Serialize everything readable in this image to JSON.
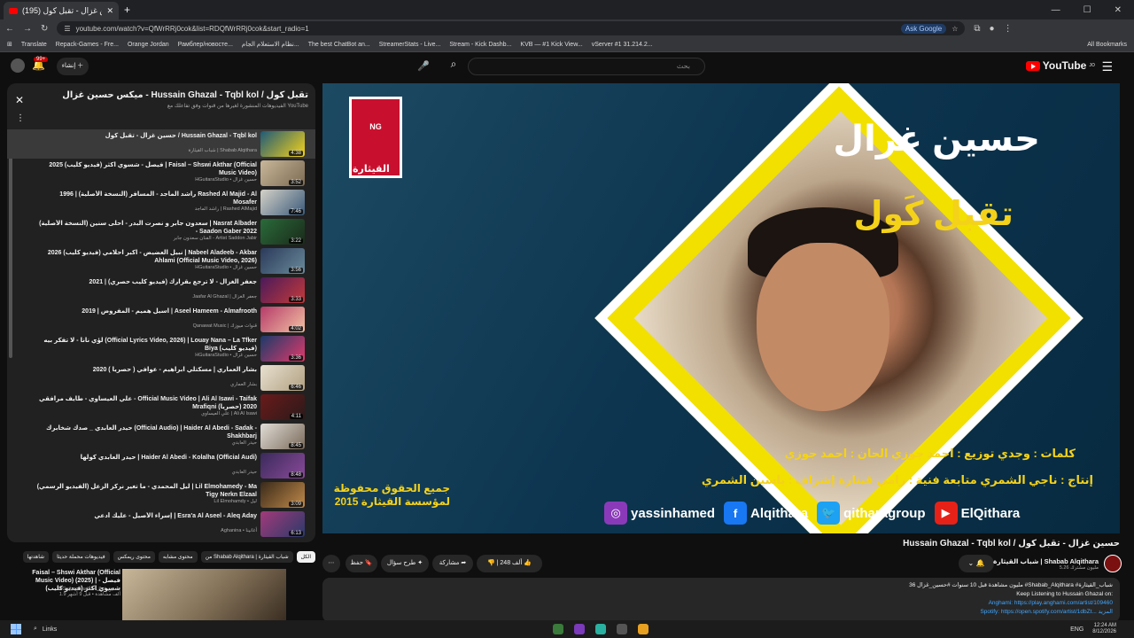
{
  "browser": {
    "tab_title": "(195) حسين غزال - تقبل كول",
    "url": "youtube.com/watch?v=QfWrRRj0cok&list=RDQfWrRRj0cok&start_radio=1",
    "ask_google": "Ask Google",
    "all_bookmarks": "All Bookmarks"
  },
  "bookmarks": [
    "Translate",
    "Repack-Games - Fre...",
    "Orange Jordan",
    "Рамблер/новосте...",
    "نظام الاستعلام الجام...",
    "The best ChatBot an...",
    "StreamerStats - Live...",
    "Stream - Kick Dashb...",
    "KVB — #1 Kick View...",
    "vServer #1 31.214.2..."
  ],
  "header": {
    "notif_count": "99+",
    "create_label": "إنشاء",
    "search_placeholder": "بحث",
    "logo": "YouTube",
    "logo_sup": "JO"
  },
  "playlist": {
    "title": "ميكس حسين غزال - Hussain Ghazal - Tqbl kol / تقبل كول",
    "subtitle": "الفيديوهات المنشورة لغيرها من قنوات وفق تفاعلك مع YouTube",
    "items": [
      {
        "title": "حسين غزال - تقبل كول / Hussain Ghazal - Tqbl kol",
        "channel": "شباب القيثارة | Shabab Alqithara",
        "dur": "4:38",
        "c1": "#1e5a78",
        "c2": "#f4d21a"
      },
      {
        "title": "فيصل - شسوي اكثر (فيديو كليب) 2025 | Faisal – Shswi Akthar (Official Music Video)",
        "channel": "HGuitaraStudio • حسين غزال",
        "dur": "3:52",
        "c1": "#c9b79a",
        "c2": "#7c6a52"
      },
      {
        "title": "راشد الماجد - المسافر (النسخة الأصلية) | 1996 Rashed Al Majid - Al Mosafer",
        "channel": "راشد الماجد | Rashed AlMajid",
        "dur": "7:46",
        "c1": "#d6d2c8",
        "c2": "#3a5a7a"
      },
      {
        "title": "سعدون جابر و نصرت البدر - احلى سنين (النسخة الأصلية) | Nasrat Albader - Saadon Gaber 2022",
        "channel": "الفنان سعدون جابر - Artist Saddon Jabir",
        "dur": "3:22",
        "c1": "#2a6b3a",
        "c2": "#1a2a1a"
      },
      {
        "title": "نبيل العضيض - اكبر احلامي (فيديو كليب) 2026 | Nabeel Aladeeb - Akbar Ahlami (Official Music Video, 2026)",
        "channel": "HGuitaraStudio • حسين غزال",
        "dur": "3:56",
        "c1": "#2a3a5a",
        "c2": "#6a8a9a"
      },
      {
        "title": "جعفر الغزال - لا ترجع بقرارك (فيديو كليب حصري) | 2021",
        "channel": "Jaafar Al Ghazal | جعفر الغزال",
        "dur": "3:33",
        "c1": "#4a1a5a",
        "c2": "#c43a3a"
      },
      {
        "title": "اسيل هميم - المفروض | 2019 | Aseel Hameem - Almafrooth",
        "channel": "Qanawat Music | قنوات ميوزك",
        "dur": "4:02",
        "c1": "#b63a6a",
        "c2": "#f2c2a2"
      },
      {
        "title": "لؤي نانا - لا تفكر بيه (Official Lyrics Video, 2026) | Louay Nana – La Tfker Biya (فيديو كليب)",
        "channel": "HGuitaraStudio • حسين غزال",
        "dur": "3:36",
        "c1": "#1a3a6a",
        "c2": "#e23a6a"
      },
      {
        "title": "بشار العماري | مسكتلي ابراهيم - عوافي ( حصريا ) 2020",
        "channel": "بشار العماري",
        "dur": "6:46",
        "c1": "#e8e0d0",
        "c2": "#b0a080"
      },
      {
        "title": "علي العيساوي - طايف مرافقي - Official Music Video | Ali Al Isawi - Taifak Mrafiqni (حصريا) 2020",
        "channel": "علي العيساوي | Ali Al Isawi",
        "dur": "4:11",
        "c1": "#6a1a1a",
        "c2": "#2a1a1a"
      },
      {
        "title": "حيدر العابدي _ صدك شخابرك (Official Audio) | Haider Al Abedi - Sadak - Shakhbarj",
        "channel": "حيدر العابدي",
        "dur": "8:45",
        "c1": "#e0ddd6",
        "c2": "#7a6a5a"
      },
      {
        "title": "حيدر العابدي كولها | Haider Al Abedi - Kolalha (Official Audi)",
        "channel": "حيدر العابدي",
        "dur": "8:48",
        "c1": "#3a2a5a",
        "c2": "#8a4a9a"
      },
      {
        "title": "ليل المحمدي - ما تغير نركز الزعل (الفيديو الرسمي) | Lil Elmohamedy - Ma Tigy Nerkn Elzaal",
        "channel": "Lil Elmohamdy • ليل",
        "dur": "3:09",
        "c1": "#3a2a1a",
        "c2": "#c08a4a"
      },
      {
        "title": "إسراء الأصيل - عليك أدعي | Esra'a Al Aseel - Aleq Aday",
        "channel": "Aghanina • أغانينا",
        "dur": "6:13",
        "c1": "#a23a7a",
        "c2": "#2a3a6a"
      }
    ]
  },
  "chips": [
    "الكل",
    "من Shabab Alqithara | شباب القيثارة",
    "محتوى مشابه",
    "محتوى ريمكس",
    "فيديوهات محملة حديثا",
    "شاهدتها"
  ],
  "next": {
    "title": "Faisal – Shswi Akthar (Official Music Video) (2025) | فيصل - شسوي اكثر (فيديو كليب)",
    "channel": "HGuitaraStudio • حسين غزال",
    "meta": "1.9 ألف مشاهدة • قبل 9 أشهر"
  },
  "player": {
    "singer": "حسين غزال",
    "song": "تقبل كَول",
    "credits1": "كلمات : وجدي  توزيع : احمد جوزي  الحان : احمد جوزي",
    "credits2": "إنتاج : ناجي الشمري  متابعة فنية : رامي قينارة  إشراف : ياسين الشمري",
    "copyright": "جميع الحقوق محفوظة لمؤسسة القيثارة 2015",
    "logo_text": "القيثارة",
    "logo_short": "NG",
    "social": [
      {
        "icon": "◎",
        "name": "yassinhamed",
        "color": "#8a3ab9"
      },
      {
        "icon": "f",
        "name": "Alqithara",
        "color": "#1877f2"
      },
      {
        "icon": "🐦",
        "name": "qitharagroup",
        "color": "#1da1f2"
      },
      {
        "icon": "▶",
        "name": "ElQithara",
        "color": "#e62117"
      }
    ]
  },
  "video": {
    "title": "Hussain Ghazal - Tqbl kol / حسين غزال - تقبل كول",
    "channel": "شباب القيثارة | Shabab Alqithara",
    "subs": "5.26 مليون مشترك",
    "likes": "248 ألف",
    "share": "مشاركة",
    "ask": "طرح سؤال",
    "save": "حفظ",
    "desc_meta": "36 مليون مشاهدة قبل 10 سنوات  #حسين_غزال #Shabab_Alqithara #شباب_القيثارة",
    "desc_l1": "Keep Listening to Hussain Ghazal on:",
    "desc_l2": "Anghami: https://play.anghami.com/artist/109460",
    "desc_l3": "Spotify: https://open.spotify.com/artist/1dbZt... المزيد"
  },
  "taskbar": {
    "links": "Links",
    "lang": "ENG",
    "time": "12:24 AM",
    "date": "8/12/2026"
  }
}
